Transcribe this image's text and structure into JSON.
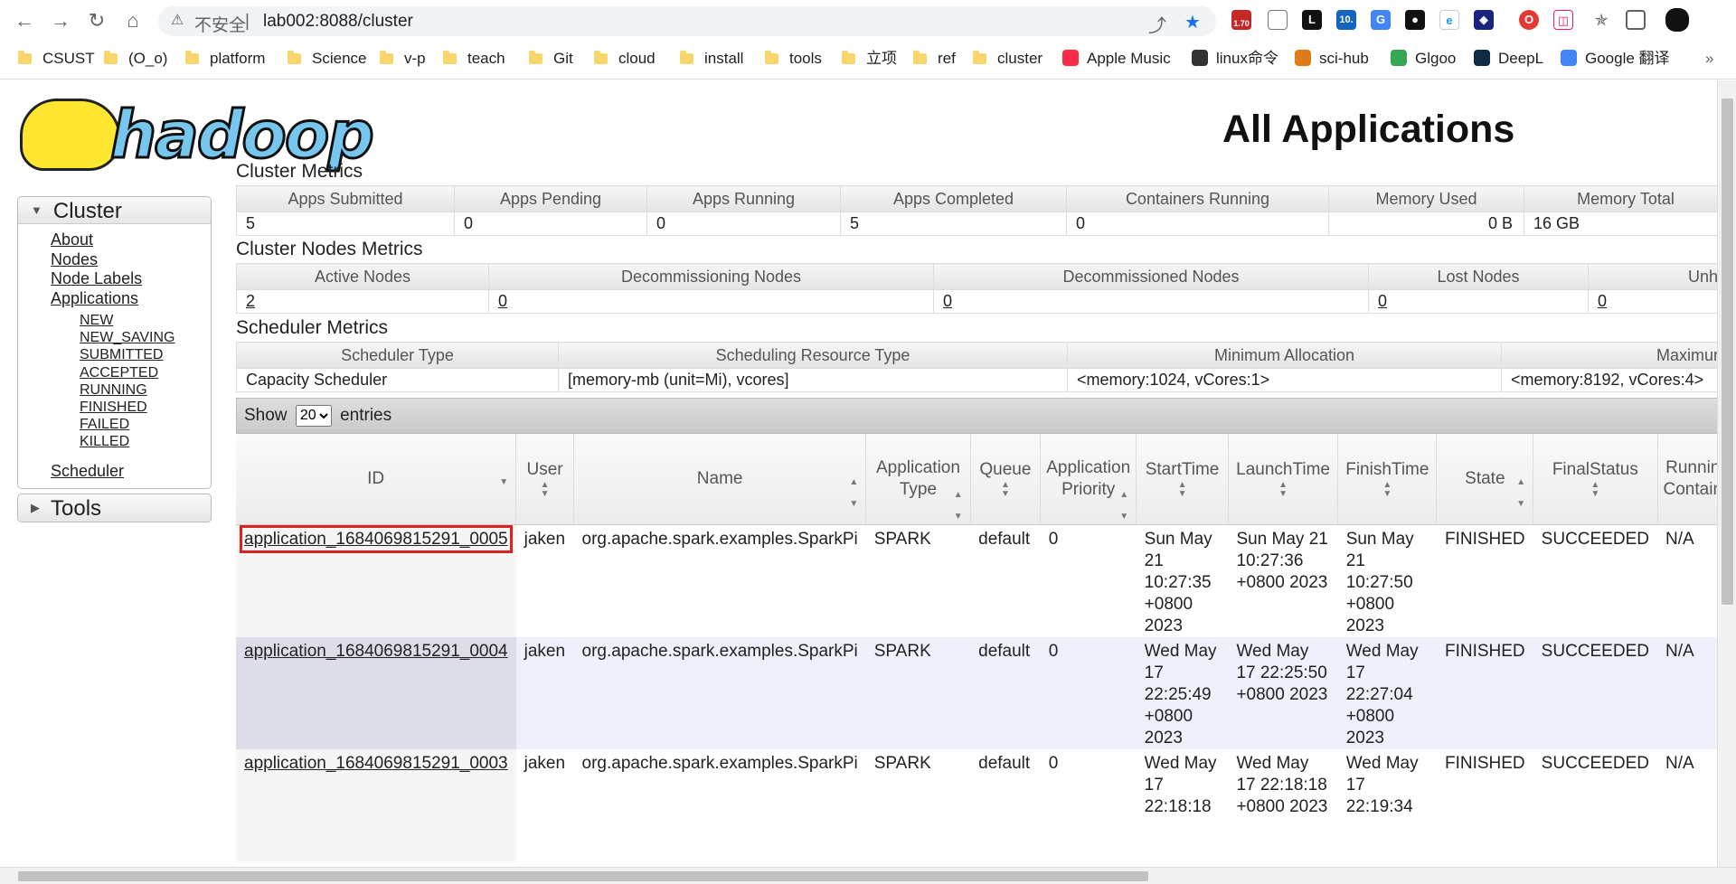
{
  "browser": {
    "security_label": "不安全",
    "url_host": "lab002:8088/cluster",
    "ext_badge": "1.70",
    "ext_10": "10.",
    "bookmarks": [
      {
        "label": "CSUST",
        "type": "folder"
      },
      {
        "label": "(O_o)",
        "type": "folder"
      },
      {
        "label": "platform",
        "type": "folder"
      },
      {
        "label": "Science",
        "type": "folder"
      },
      {
        "label": "v-p",
        "type": "folder"
      },
      {
        "label": "teach",
        "type": "folder"
      },
      {
        "label": "Git",
        "type": "folder"
      },
      {
        "label": "cloud",
        "type": "folder"
      },
      {
        "label": "install",
        "type": "folder"
      },
      {
        "label": "tools",
        "type": "folder"
      },
      {
        "label": "立项",
        "type": "folder"
      },
      {
        "label": "ref",
        "type": "folder"
      },
      {
        "label": "cluster",
        "type": "folder"
      },
      {
        "label": "Apple Music",
        "type": "site",
        "color": "#fa2d48"
      },
      {
        "label": "linux命令",
        "type": "site",
        "color": "#333333"
      },
      {
        "label": "sci-hub",
        "type": "site",
        "color": "#e07b1a"
      },
      {
        "label": "Glgoo",
        "type": "site",
        "color": "#34a853"
      },
      {
        "label": "DeepL",
        "type": "site",
        "color": "#0f2b46"
      },
      {
        "label": "Google 翻译",
        "type": "site",
        "color": "#4285f4"
      }
    ]
  },
  "header": {
    "logo_text": "hadoop",
    "title": "All Applications"
  },
  "nav": {
    "cluster_title": "Cluster",
    "cluster_links": [
      "About",
      "Nodes",
      "Node Labels",
      "Applications"
    ],
    "app_states": [
      "NEW",
      "NEW_SAVING",
      "SUBMITTED",
      "ACCEPTED",
      "RUNNING",
      "FINISHED",
      "FAILED",
      "KILLED"
    ],
    "scheduler_link": "Scheduler",
    "tools_title": "Tools"
  },
  "cluster_metrics": {
    "title": "Cluster Metrics",
    "headers": [
      "Apps Submitted",
      "Apps Pending",
      "Apps Running",
      "Apps Completed",
      "Containers Running",
      "Memory Used",
      "Memory Total"
    ],
    "values": [
      "5",
      "0",
      "0",
      "5",
      "0",
      "0 B",
      "16 GB"
    ]
  },
  "nodes_metrics": {
    "title": "Cluster Nodes Metrics",
    "headers": [
      "Active Nodes",
      "Decommissioning Nodes",
      "Decommissioned Nodes",
      "Lost Nodes",
      "Unhe"
    ],
    "values": [
      "2",
      "0",
      "0",
      "0",
      "0"
    ]
  },
  "scheduler_metrics": {
    "title": "Scheduler Metrics",
    "headers": [
      "Scheduler Type",
      "Scheduling Resource Type",
      "Minimum Allocation",
      "Maximum"
    ],
    "values": [
      "Capacity Scheduler",
      "[memory-mb (unit=Mi), vcores]",
      "<memory:1024, vCores:1>",
      "<memory:8192, vCores:4>"
    ]
  },
  "entries": {
    "show_label": "Show",
    "selected": "20",
    "entries_label": "entries"
  },
  "apps_table": {
    "columns": [
      "ID",
      "User",
      "Name",
      "Application Type",
      "Queue",
      "Application Priority",
      "StartTime",
      "LaunchTime",
      "FinishTime",
      "State",
      "FinalStatus",
      "Runnin Contain"
    ],
    "rows": [
      {
        "id": "application_1684069815291_0005",
        "user": "jaken",
        "name": "org.apache.spark.examples.SparkPi",
        "type": "SPARK",
        "queue": "default",
        "priority": "0",
        "start": "Sun May 21 10:27:35 +0800 2023",
        "launch": "Sun May 21 10:27:36 +0800 2023",
        "finish": "Sun May 21 10:27:50 +0800 2023",
        "state": "FINISHED",
        "final_status": "SUCCEEDED",
        "running": "N/A"
      },
      {
        "id": "application_1684069815291_0004",
        "user": "jaken",
        "name": "org.apache.spark.examples.SparkPi",
        "type": "SPARK",
        "queue": "default",
        "priority": "0",
        "start": "Wed May 17 22:25:49 +0800 2023",
        "launch": "Wed May 17 22:25:50 +0800 2023",
        "finish": "Wed May 17 22:27:04 +0800 2023",
        "state": "FINISHED",
        "final_status": "SUCCEEDED",
        "running": "N/A"
      },
      {
        "id": "application_1684069815291_0003",
        "user": "jaken",
        "name": "org.apache.spark.examples.SparkPi",
        "type": "SPARK",
        "queue": "default",
        "priority": "0",
        "start": "Wed May 17 22:18:18",
        "launch": "Wed May 17 22:18:18 +0800 2023",
        "finish": "Wed May 17 22:19:34",
        "state": "FINISHED",
        "final_status": "SUCCEEDED",
        "running": "N/A"
      }
    ]
  }
}
